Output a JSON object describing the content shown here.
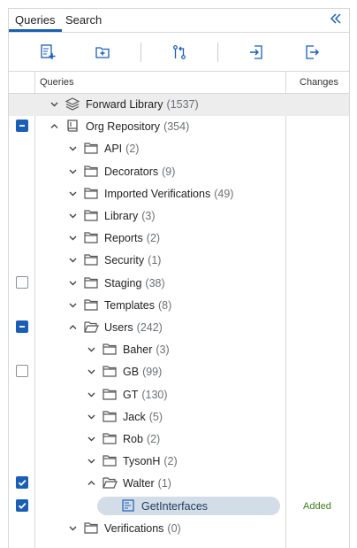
{
  "tabs": {
    "queries": "Queries",
    "search": "Search"
  },
  "columns": {
    "queries": "Queries",
    "changes": "Changes"
  },
  "colors": {
    "accent": "#1a5fb4",
    "selected_row": "#d3dde8",
    "added": "#3d7a1e"
  },
  "tree": [
    {
      "label": "Forward Library",
      "count": "(1537)",
      "icon": "library-stack-icon",
      "expanded": true
    },
    {
      "label": "Org Repository",
      "count": "(354)",
      "icon": "repository-book-icon",
      "expanded": true,
      "checkbox": "partial"
    },
    {
      "label": "API",
      "count": "(2)",
      "icon": "folder-icon",
      "expanded": false
    },
    {
      "label": "Decorators",
      "count": "(9)",
      "icon": "folder-icon",
      "expanded": false
    },
    {
      "label": "Imported Verifications",
      "count": "(49)",
      "icon": "folder-icon",
      "expanded": false
    },
    {
      "label": "Library",
      "count": "(3)",
      "icon": "folder-icon",
      "expanded": false
    },
    {
      "label": "Reports",
      "count": "(2)",
      "icon": "folder-icon",
      "expanded": false
    },
    {
      "label": "Security",
      "count": "(1)",
      "icon": "folder-icon",
      "expanded": false
    },
    {
      "label": "Staging",
      "count": "(38)",
      "icon": "folder-icon",
      "expanded": false,
      "checkbox": "unchecked"
    },
    {
      "label": "Templates",
      "count": "(8)",
      "icon": "folder-icon",
      "expanded": false
    },
    {
      "label": "Users",
      "count": "(242)",
      "icon": "folder-open-icon",
      "expanded": true,
      "checkbox": "partial"
    },
    {
      "label": "Baher",
      "count": "(3)",
      "icon": "folder-icon",
      "expanded": false
    },
    {
      "label": "GB",
      "count": "(99)",
      "icon": "folder-icon",
      "expanded": false,
      "checkbox": "unchecked"
    },
    {
      "label": "GT",
      "count": "(130)",
      "icon": "folder-icon",
      "expanded": false
    },
    {
      "label": "Jack",
      "count": "(5)",
      "icon": "folder-icon",
      "expanded": false
    },
    {
      "label": "Rob",
      "count": "(2)",
      "icon": "folder-icon",
      "expanded": false
    },
    {
      "label": "TysonH",
      "count": "(2)",
      "icon": "folder-icon",
      "expanded": false
    },
    {
      "label": "Walter",
      "count": "(1)",
      "icon": "folder-open-icon",
      "expanded": true,
      "checkbox": "checked"
    },
    {
      "label": "GetInterfaces",
      "count": "",
      "icon": "query-file-icon",
      "selected": true,
      "checkbox": "checked",
      "change": "Added"
    },
    {
      "label": "Verifications",
      "count": "(0)",
      "icon": "folder-icon",
      "expanded": false
    }
  ]
}
